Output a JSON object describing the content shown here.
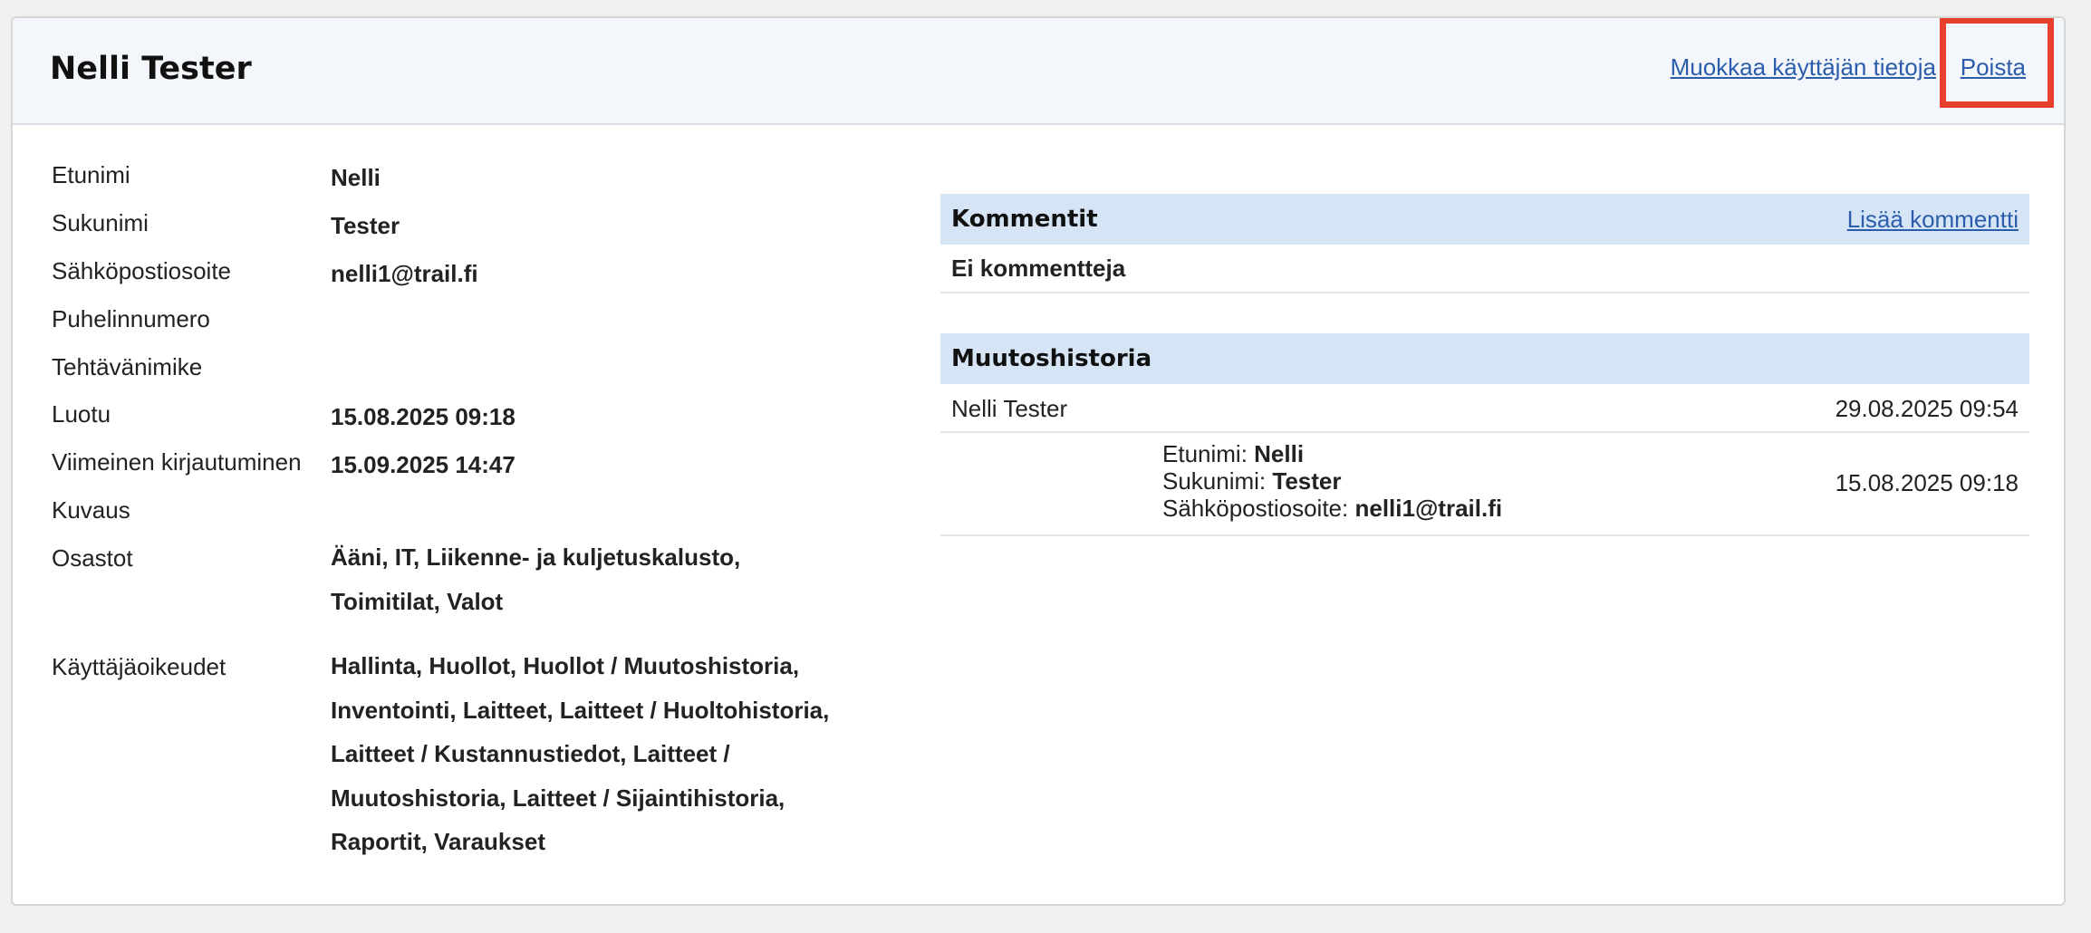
{
  "header": {
    "title": "Nelli Tester",
    "edit_link": "Muokkaa käyttäjän tietoja",
    "separator": "|",
    "delete_link": "Poista"
  },
  "details": [
    {
      "label": "Etunimi",
      "value": "Nelli"
    },
    {
      "label": "Sukunimi",
      "value": "Tester"
    },
    {
      "label": "Sähköpostiosoite",
      "value": "nelli1@trail.fi"
    },
    {
      "label": "Puhelinnumero",
      "value": ""
    },
    {
      "label": "Tehtävänimike",
      "value": ""
    },
    {
      "label": "Luotu",
      "value": "15.08.2025 09:18"
    },
    {
      "label": "Viimeinen kirjautuminen",
      "value": "15.09.2025 14:47"
    },
    {
      "label": "Kuvaus",
      "value": ""
    },
    {
      "label": "Osastot",
      "value": "Ääni, IT, Liikenne- ja kuljetuskalusto, Toimitilat, Valot"
    },
    {
      "label": "Käyttäjäoikeudet",
      "value": "Hallinta, Huollot, Huollot / Muutoshistoria, Inventointi, Laitteet, Laitteet / Huoltohistoria, Laitteet / Kustannustiedot, Laitteet / Muutoshistoria, Laitteet / Sijaintihistoria, Raportit, Varaukset"
    }
  ],
  "comments": {
    "title": "Kommentit",
    "add_link": "Lisää kommentti",
    "empty_text": "Ei kommentteja"
  },
  "history": {
    "title": "Muutoshistoria",
    "entries": [
      {
        "user": "Nelli Tester",
        "date": "29.08.2025 09:54"
      },
      {
        "date": "15.08.2025 09:18",
        "changes": [
          {
            "field": "Etunimi:",
            "value": "Nelli"
          },
          {
            "field": "Sukunimi:",
            "value": "Tester"
          },
          {
            "field": "Sähköpostiosoite:",
            "value": "nelli1@trail.fi"
          }
        ]
      }
    ]
  },
  "colors": {
    "link": "#2b5dac",
    "section_header_bg": "#d6e5f6",
    "panel_header_bg": "#f3f6fa",
    "highlight": "#e8402f"
  }
}
